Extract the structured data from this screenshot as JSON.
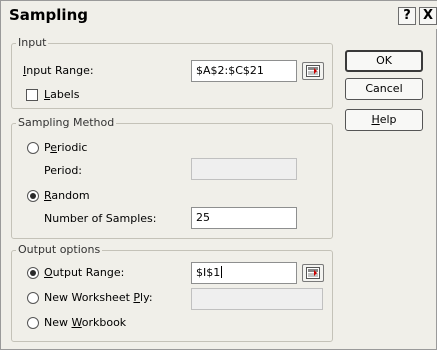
{
  "dialog": {
    "title": "Sampling"
  },
  "title_buttons": {
    "help": "?",
    "close": "X"
  },
  "input_group": {
    "label": "Input",
    "input_range_label_prefix": "",
    "input_range_label_key": "I",
    "input_range_label_rest": "nput Range:",
    "input_range_value": "$A$2:$C$21",
    "labels_key": "L",
    "labels_rest": "abels",
    "labels_checked": false
  },
  "sampling_method": {
    "label": "Sampling Method",
    "periodic_pre": "P",
    "periodic_key": "e",
    "periodic_rest": "riodic",
    "periodic_selected": false,
    "period_label": "Period:",
    "period_value": "",
    "random_key": "R",
    "random_rest": "andom",
    "random_selected": true,
    "num_samples_label": "Number of Samples:",
    "num_samples_value": "25"
  },
  "output_options": {
    "label": "Output options",
    "output_range_key": "O",
    "output_range_rest": "utput Range:",
    "output_range_selected": true,
    "output_range_value": "$I$1",
    "new_ply_pre": "New Worksheet ",
    "new_ply_key": "P",
    "new_ply_rest": "ly:",
    "new_ply_selected": false,
    "new_ply_value": "",
    "new_workbook_pre": "New ",
    "new_workbook_key": "W",
    "new_workbook_rest": "orkbook",
    "new_workbook_selected": false
  },
  "buttons": {
    "ok": "OK",
    "cancel": "Cancel",
    "help_key": "H",
    "help_rest": "elp"
  },
  "icons": {
    "collapse": "collapse-dialog-icon",
    "help": "help-icon",
    "close": "close-icon"
  }
}
